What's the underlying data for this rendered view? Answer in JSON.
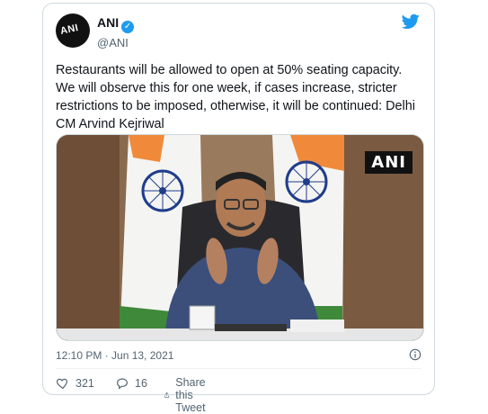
{
  "tweet": {
    "display_name": "ANI",
    "handle": "@ANI",
    "avatar_text": "ANI",
    "verified_glyph": "✓",
    "text": "Restaurants will be allowed to open at 50% seating capacity. We will observe this for one week, if cases increase, stricter restrictions to be imposed, otherwise, it will be continued: Delhi CM Arvind Kejriwal",
    "media_watermark": "ANI",
    "timestamp": "12:10 PM · Jun 13, 2021",
    "likes": "321",
    "replies": "16",
    "share_label": "Share this Tweet"
  },
  "icons": [
    "twitter-bird-icon",
    "verified-badge-icon",
    "info-icon",
    "heart-icon",
    "reply-icon",
    "share-icon"
  ],
  "colors": {
    "brand_blue": "#1d9bf0",
    "text": "#0f1419",
    "muted": "#536471",
    "border": "#cfd9de"
  }
}
